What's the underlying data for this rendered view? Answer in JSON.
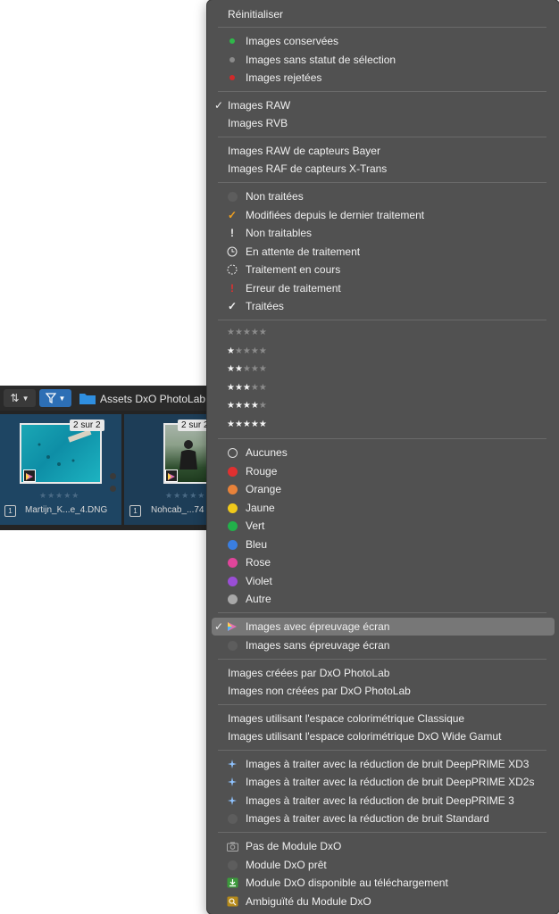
{
  "filmstrip": {
    "title": "Assets DxO PhotoLab",
    "thumbnails": [
      {
        "badge": "2 sur 2",
        "number": "1",
        "filename": "Martijn_K...e_4.DNG",
        "stars": "★★★★★"
      },
      {
        "badge": "2 sur 2",
        "number": "1",
        "filename": "Nohcab_...74",
        "stars": "★★★★★"
      }
    ]
  },
  "menu": {
    "reset": "Réinitialiser",
    "selection": [
      {
        "label": "Images conservées",
        "color": "#2fb84a"
      },
      {
        "label": "Images sans statut de sélection",
        "color": "#8a8a8a"
      },
      {
        "label": "Images rejetées",
        "color": "#d02a2a"
      }
    ],
    "format": [
      {
        "label": "Images RAW",
        "checked": true
      },
      {
        "label": "Images RVB",
        "checked": false
      }
    ],
    "sensor": [
      "Images RAW de capteurs Bayer",
      "Images RAF de capteurs X-Trans"
    ],
    "processing": [
      {
        "label": "Non traitées",
        "icon": "unprocessed-icon"
      },
      {
        "label": "Modifiées depuis le dernier traitement",
        "icon": "checkmark-orange-icon"
      },
      {
        "label": "Non traitables",
        "icon": "exclamation-icon"
      },
      {
        "label": "En attente de traitement",
        "icon": "clock-icon"
      },
      {
        "label": "Traitement en cours",
        "icon": "spinner-icon"
      },
      {
        "label": "Erreur de traitement",
        "icon": "error-icon"
      },
      {
        "label": "Traitées",
        "icon": "checkmark-icon"
      }
    ],
    "ratings": [
      0,
      1,
      2,
      3,
      4,
      5
    ],
    "colors": [
      {
        "label": "Aucunes",
        "color": "none"
      },
      {
        "label": "Rouge",
        "color": "#e03030"
      },
      {
        "label": "Orange",
        "color": "#e8823a"
      },
      {
        "label": "Jaune",
        "color": "#f0c91a"
      },
      {
        "label": "Vert",
        "color": "#22b04a"
      },
      {
        "label": "Bleu",
        "color": "#3a7ee0"
      },
      {
        "label": "Rose",
        "color": "#e0459a"
      },
      {
        "label": "Violet",
        "color": "#9a4ed6"
      },
      {
        "label": "Autre",
        "color": "#a8a8a8"
      }
    ],
    "softproof": [
      {
        "label": "Images avec épreuvage écran",
        "checked": true,
        "highlighted": true
      },
      {
        "label": "Images sans épreuvage écran",
        "checked": false
      }
    ],
    "created": [
      "Images créées par DxO PhotoLab",
      "Images non créées par DxO PhotoLab"
    ],
    "colorspace": [
      "Images utilisant l'espace colorimétrique Classique",
      "Images utilisant l'espace colorimétrique DxO Wide Gamut"
    ],
    "denoise": [
      "Images à traiter avec la réduction de bruit DeepPRIME XD3",
      "Images à traiter avec la réduction de bruit DeepPRIME XD2s",
      "Images à traiter avec la réduction de bruit DeepPRIME 3",
      "Images à traiter avec la réduction de bruit Standard"
    ],
    "module": [
      {
        "label": "Pas de Module DxO",
        "icon": "camera-icon"
      },
      {
        "label": "Module DxO prêt",
        "icon": "module-ready-icon"
      },
      {
        "label": "Module DxO disponible au téléchargement",
        "icon": "download-icon"
      },
      {
        "label": "Ambiguïté du Module DxO",
        "icon": "search-warning-icon"
      }
    ]
  }
}
